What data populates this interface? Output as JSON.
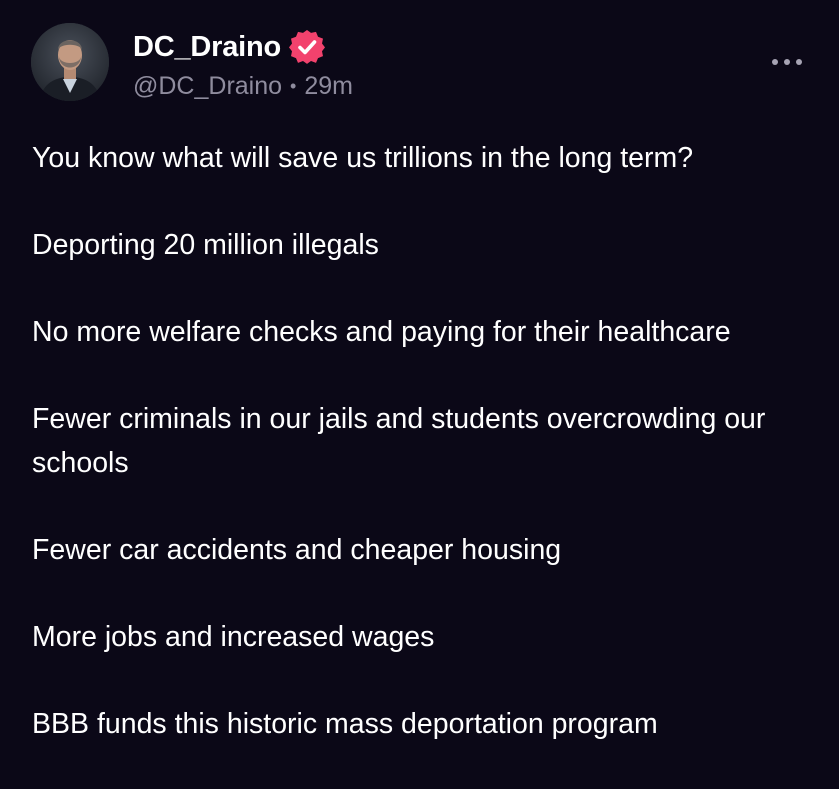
{
  "post": {
    "author": {
      "display_name": "DC_Draino",
      "handle": "@DC_Draino",
      "verified": true,
      "verified_color": "#f2426d",
      "avatar_icon": "profile-photo"
    },
    "separator": "•",
    "time": "29m",
    "more_icon": "more-horizontal-icon",
    "paragraphs": [
      "You know what will save us trillions in the long term?",
      "Deporting 20 million illegals",
      "No more welfare checks and paying for their healthcare",
      "Fewer criminals in our jails and students overcrowding our schools",
      "Fewer car accidents and cheaper housing",
      "More jobs and increased wages",
      "BBB funds this historic mass deportation program"
    ]
  },
  "colors": {
    "background": "#0b0817",
    "text": "#ffffff",
    "muted": "#8f8c9e"
  }
}
